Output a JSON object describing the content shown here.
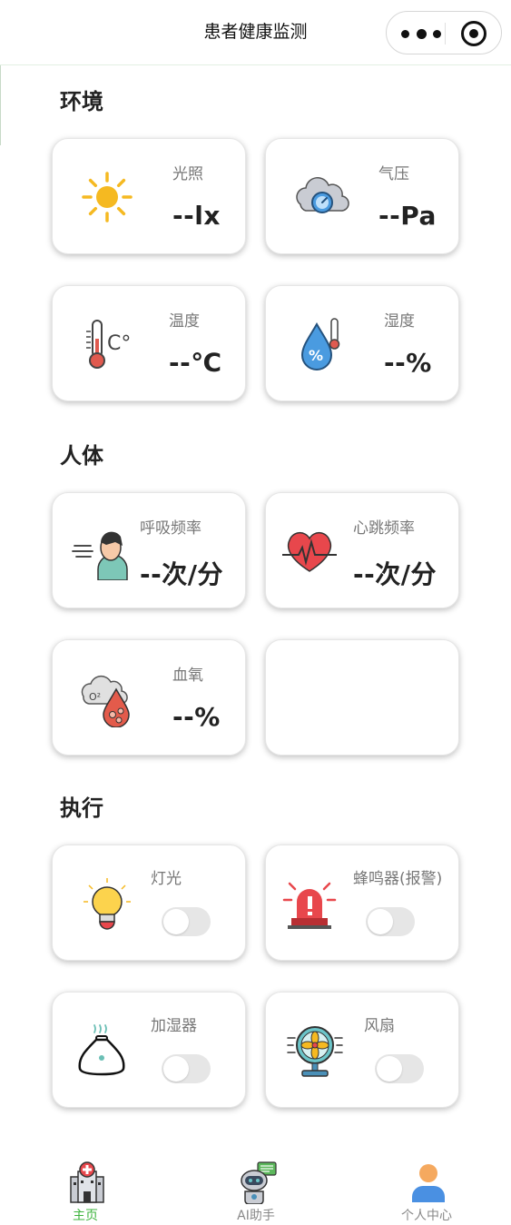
{
  "nav": {
    "title": "患者健康监测"
  },
  "sections": {
    "environment": "环境",
    "body": "人体",
    "actuators": "执行"
  },
  "environment": {
    "light": {
      "label": "光照",
      "value": "--lx"
    },
    "pressure": {
      "label": "气压",
      "value": "--Pa"
    },
    "temperature": {
      "label": "温度",
      "value": "--℃"
    },
    "humidity": {
      "label": "湿度",
      "value": "--%"
    }
  },
  "body": {
    "respiration": {
      "label": "呼吸频率",
      "value": "--次/分"
    },
    "heart_rate": {
      "label": "心跳频率",
      "value": "--次/分"
    },
    "blood_oxygen": {
      "label": "血氧",
      "value": "--%"
    }
  },
  "actuators": {
    "light": {
      "label": "灯光",
      "on": false
    },
    "buzzer": {
      "label": "蜂鸣器(报警)",
      "on": false
    },
    "humidifier": {
      "label": "加湿器",
      "on": false
    },
    "fan": {
      "label": "风扇",
      "on": false
    }
  },
  "tabbar": {
    "items": [
      {
        "label": "主页",
        "icon": "hospital-icon",
        "active": true
      },
      {
        "label": "AI助手",
        "icon": "robot-icon",
        "active": false
      },
      {
        "label": "个人中心",
        "icon": "user-icon",
        "active": false
      }
    ],
    "active_color": "#3cb33c"
  }
}
